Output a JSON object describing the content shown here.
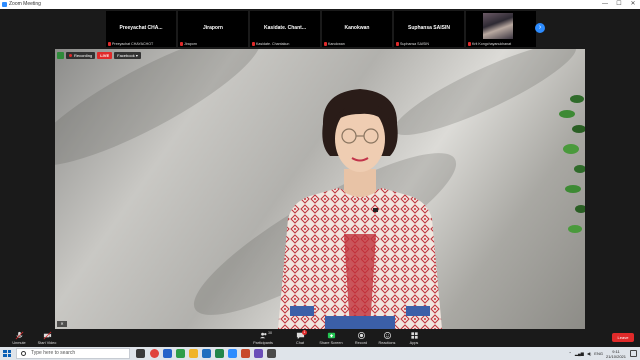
{
  "window": {
    "title": "Zoom Meeting",
    "min": "—",
    "max": "☐",
    "close": "✕"
  },
  "gallery": {
    "tiles": [
      {
        "name": "Preeyachat  CHA...",
        "label": "Preeyachat CHAYACHOT"
      },
      {
        "name": "Jiraporn",
        "label": "Jiraporn"
      },
      {
        "name": "Kasidate.  Chant...",
        "label": "Kasidate. Chantakun"
      },
      {
        "name": "Kanokwan",
        "label": "Kanokwan"
      },
      {
        "name": "Suphansa SAISIN",
        "label": "Suphansa SAISIN"
      },
      {
        "name": "",
        "label": "Krit Kongchayanukhanat"
      }
    ],
    "next": "›"
  },
  "video": {
    "recording": "Recording",
    "live": "LIVE",
    "live_target": "Facebook"
  },
  "controls": {
    "unmute": "Unmute",
    "start_video": "Start Video",
    "participants": "Participants",
    "participants_count": "38",
    "chat": "Chat",
    "chat_badge": "1",
    "share_screen": "Share Screen",
    "record": "Record",
    "reactions": "Reactions",
    "apps": "Apps",
    "leave": "Leave"
  },
  "taskbar": {
    "search_placeholder": "Type here to search",
    "lang": "ENG",
    "time": "9:11",
    "date": "21/10/2021"
  },
  "colors": {
    "zoom_blue": "#2D8CFF",
    "leave_red": "#E02A2A",
    "share_green": "#23C552"
  }
}
